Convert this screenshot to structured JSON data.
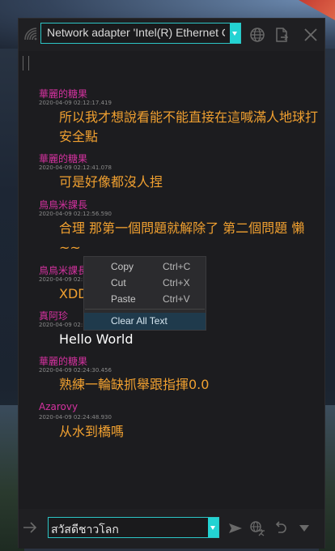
{
  "toolbar": {
    "adapter_value": "Network adapter 'Intel(R) Ethernet Connection'"
  },
  "messages": [
    {
      "name": "華麗的糖果",
      "time": "2020-04-09 02:12:17.419",
      "text": "所以我才想說看能不能直接在這喊滿人地球打安全點"
    },
    {
      "name": "華麗的糖果",
      "time": "2020-04-09 02:12:41.078",
      "text": "可是好像都沒人捏"
    },
    {
      "name": "鳥鳥米課長",
      "time": "2020-04-09 02:12:56.590",
      "text": "合理 那第一個問題就解除了 第二個問題 懶~~"
    },
    {
      "name": "鳥鳥米課長",
      "time": "2020-04-09 02:13:",
      "text": "XDD"
    },
    {
      "name": "真阿珍",
      "time": "2020-04-09 02:",
      "text": "Hello World"
    },
    {
      "name": "華麗的糖果",
      "time": "2020-04-09 02:24:30.456",
      "text": "熟練一輪缺抓舉跟指揮0.0"
    },
    {
      "name": "Azarovy",
      "time": "2020-04-09 02:24:48.930",
      "text": "从水到橋嗎"
    }
  ],
  "context_menu": {
    "copy": {
      "label": "Copy",
      "shortcut": "Ctrl+C"
    },
    "cut": {
      "label": "Cut",
      "shortcut": "Ctrl+X"
    },
    "paste": {
      "label": "Paste",
      "shortcut": "Ctrl+V"
    },
    "clear": {
      "label": "Clear All Text"
    }
  },
  "input": {
    "value": "สวัสดีชาวโลก"
  },
  "colors": {
    "accent": "#23d3d3",
    "name": "#d4329f",
    "message": "#f0a030",
    "highlight": "#1f3a4c"
  },
  "icons": [
    "network-icon",
    "globe-icon",
    "export-icon",
    "close-icon",
    "arrow-right-icon",
    "send-icon",
    "translate-icon",
    "undo-icon",
    "dropdown-icon"
  ]
}
